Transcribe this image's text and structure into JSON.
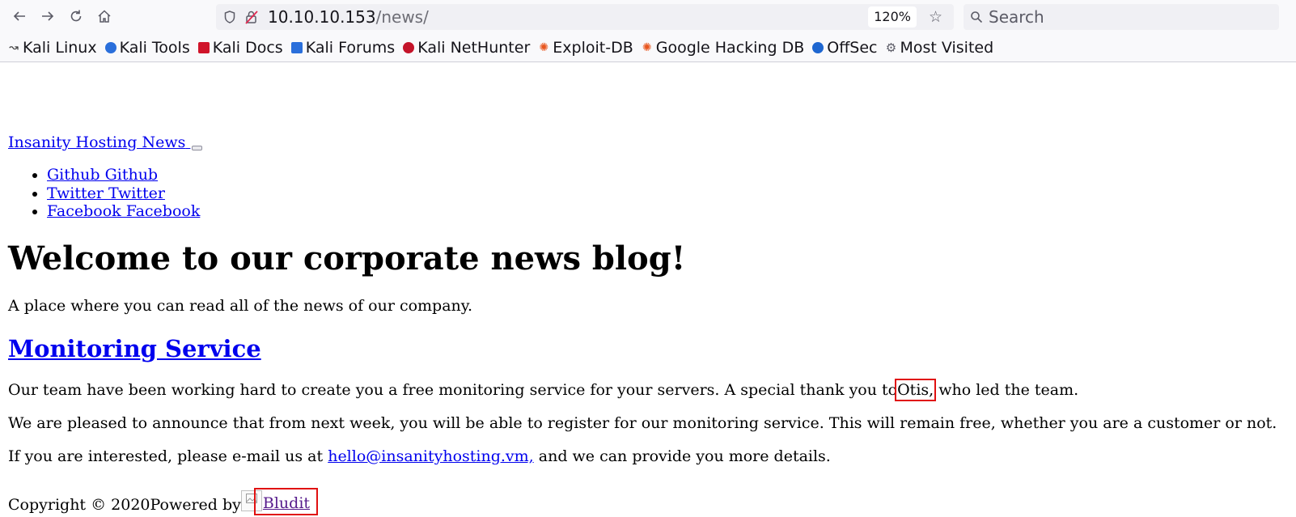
{
  "browser": {
    "url_host": "10.10.10.153",
    "url_path": "/news/",
    "zoom": "120%",
    "search_placeholder": "Search",
    "bookmarks": [
      {
        "label": "Kali Linux",
        "icon": "kali-dragon-icon"
      },
      {
        "label": "Kali Tools",
        "icon": "kali-tools-icon"
      },
      {
        "label": "Kali Docs",
        "icon": "kali-docs-icon"
      },
      {
        "label": "Kali Forums",
        "icon": "kali-forums-icon"
      },
      {
        "label": "Kali NetHunter",
        "icon": "kali-nethunter-icon"
      },
      {
        "label": "Exploit-DB",
        "icon": "exploit-db-icon"
      },
      {
        "label": "Google Hacking DB",
        "icon": "ghdb-icon"
      },
      {
        "label": "OffSec",
        "icon": "offsec-icon"
      },
      {
        "label": "Most Visited",
        "icon": "gear-icon"
      }
    ]
  },
  "site": {
    "title": "Insanity Hosting News",
    "social": [
      "Github Github",
      "Twitter Twitter",
      "Facebook Facebook"
    ]
  },
  "hero": {
    "heading": "Welcome to our corporate news blog!",
    "lede": "A place where you can read all of the news of our company."
  },
  "post": {
    "title": "Monitoring Service",
    "p1_before": "Our team have been working hard to create you a free monitoring service for your servers. A special thank you to",
    "p1_name": "Otis,",
    "p1_after": "who led the team.",
    "p2": "We are pleased to announce that from next week, you will be able to register for our monitoring service. This will remain free, whether you are a customer or not.",
    "p3_before": "If you are interested, please e-mail us at",
    "p3_email": "hello@insanityhosting.vm,",
    "p3_after": "and we can provide you more details."
  },
  "footer": {
    "copyright": "Copyright © 2020Powered by",
    "bludit": "Bludit"
  },
  "colors": {
    "link": "#0000ee",
    "visited": "#551a8b",
    "highlight": "#e01010"
  }
}
